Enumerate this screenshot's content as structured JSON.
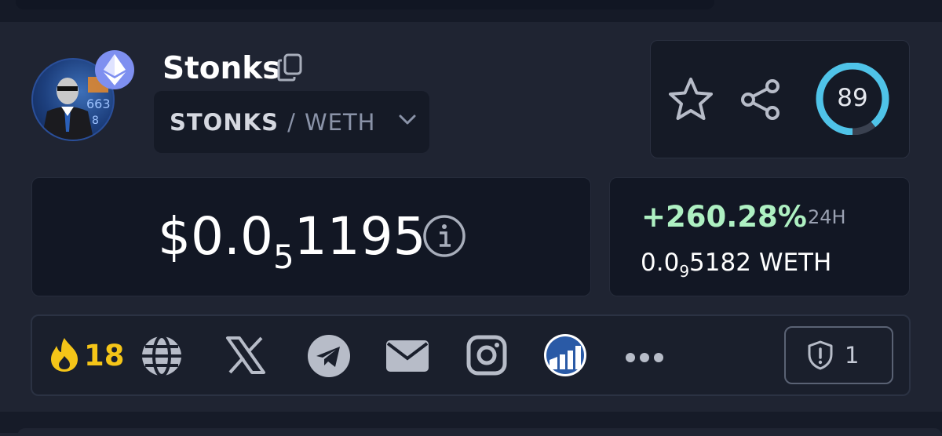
{
  "token": {
    "name": "Stonks",
    "pair_base": "STONKS",
    "pair_separator": "/",
    "pair_quote": "WETH"
  },
  "score": {
    "value": "89",
    "fraction": 0.89,
    "ring_color": "#4fc3e8"
  },
  "price": {
    "prefix": "$0.0",
    "zeros_subscript": "5",
    "digits": "1195"
  },
  "change": {
    "percent": "+260.28%",
    "period": "24H",
    "color": "#aef0c2"
  },
  "quote_price": {
    "prefix": "0.0",
    "zeros_subscript": "9",
    "digits": "5182",
    "unit": "WETH"
  },
  "hot": {
    "count": "18",
    "color": "#f5c518"
  },
  "links": [
    {
      "icon": "globe-icon"
    },
    {
      "icon": "x-icon"
    },
    {
      "icon": "telegram-icon"
    },
    {
      "icon": "email-icon"
    },
    {
      "icon": "instagram-icon"
    },
    {
      "icon": "coinmarketcap-icon"
    },
    {
      "icon": "more-icon"
    }
  ],
  "audit": {
    "count": "1"
  }
}
